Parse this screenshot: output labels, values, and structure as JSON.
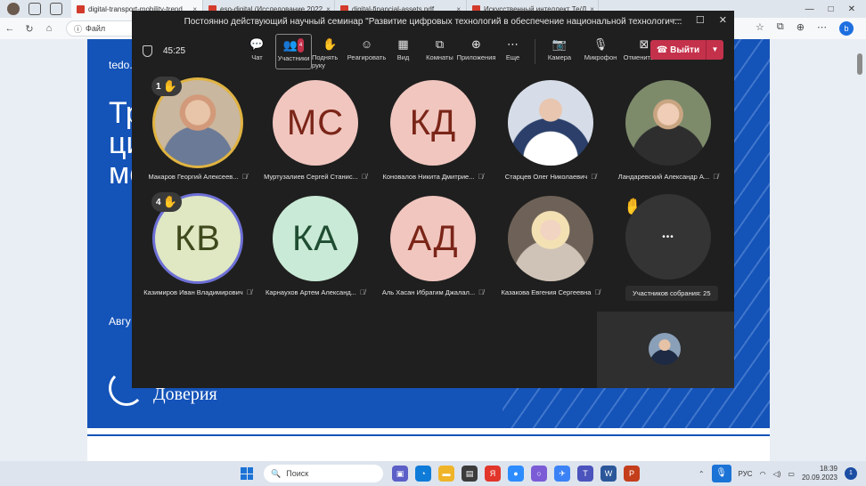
{
  "browser": {
    "tabs": [
      {
        "label": "digital-transport-mobility-trend",
        "active": true
      },
      {
        "label": "eso-digital (Исследование 2022",
        "active": false
      },
      {
        "label": "digital-financial-assets.pdf",
        "active": false
      },
      {
        "label": "Искусственный интеллект Те/Д",
        "active": false
      }
    ],
    "address_label": "Файл",
    "close_glyph": "×"
  },
  "slide": {
    "brand": "tedo.",
    "big_text": "Тр\nци\nмо",
    "month": "Авгу",
    "logo_text": "Доверия"
  },
  "meeting": {
    "title": "Постоянно действующий научный семинар \"Развитие цифровых технологий в обеспечение национальной технологич...",
    "timer": "45:25",
    "toolbar": [
      {
        "label": "Чат",
        "icon": "chat-icon",
        "glyph": "💬"
      },
      {
        "label": "Участники",
        "icon": "people-icon",
        "glyph": "👥",
        "badge": "4",
        "selected": true
      },
      {
        "label": "Поднять руку",
        "icon": "raise-hand-icon",
        "glyph": "✋"
      },
      {
        "label": "Реагировать",
        "icon": "react-icon",
        "glyph": "☺"
      },
      {
        "label": "Вид",
        "icon": "view-icon",
        "glyph": "▦"
      },
      {
        "label": "Комнаты",
        "icon": "rooms-icon",
        "glyph": "⧉"
      },
      {
        "label": "Приложения",
        "icon": "apps-icon",
        "glyph": "⊕"
      },
      {
        "label": "Еще",
        "icon": "more-icon",
        "glyph": "⋯"
      }
    ],
    "device_controls": [
      {
        "label": "Камера",
        "icon": "camera-off-icon",
        "glyph": "📷"
      },
      {
        "label": "Микрофон",
        "icon": "microphone-icon",
        "glyph": "🎙"
      },
      {
        "label": "Отменить о...",
        "icon": "stop-share-icon",
        "glyph": "⊠"
      }
    ],
    "leave_label": "Выйти",
    "participants": [
      {
        "name": "Макаров Георгий Алексеев...",
        "initials": "",
        "photo": "p1",
        "hand": "1",
        "ring": "gold"
      },
      {
        "name": "Муртузалиев Сергей Станис...",
        "initials": "МС",
        "bg": "#f1c6bf",
        "fg": "#7a2518"
      },
      {
        "name": "Коновалов Никита Дмитрие...",
        "initials": "КД",
        "bg": "#f1c6bf",
        "fg": "#7a2518"
      },
      {
        "name": "Старцев Олег Николаевич",
        "initials": "",
        "photo": "p2"
      },
      {
        "name": "Ландаревский Александр А...",
        "initials": "",
        "photo": "p3"
      },
      {
        "name": "Казимиров Иван Владимирович",
        "initials": "КВ",
        "bg": "#dfe7c3",
        "fg": "#3e4a1c",
        "hand": "4",
        "ring": "blue"
      },
      {
        "name": "Карнаухов Артем Александ...",
        "initials": "КА",
        "bg": "#c9ead6",
        "fg": "#1f4d32"
      },
      {
        "name": "Аль Хасан Ибрагим Джалал...",
        "initials": "АД",
        "bg": "#f1c6bf",
        "fg": "#7a2518"
      },
      {
        "name": "Казакова Евгения Сергеевна",
        "initials": "",
        "photo": "p4"
      }
    ],
    "overflow_tooltip": "Участников собрания: 25",
    "more_glyph": "•••"
  },
  "taskbar": {
    "search_placeholder": "Поиск",
    "language": "РУС",
    "time": "18:39",
    "date": "20.09.2023",
    "notifications": "1"
  },
  "colors": {
    "accent_leave": "#c4314b",
    "hand": "#f2c21b",
    "slide_blue": "#1453b8"
  }
}
